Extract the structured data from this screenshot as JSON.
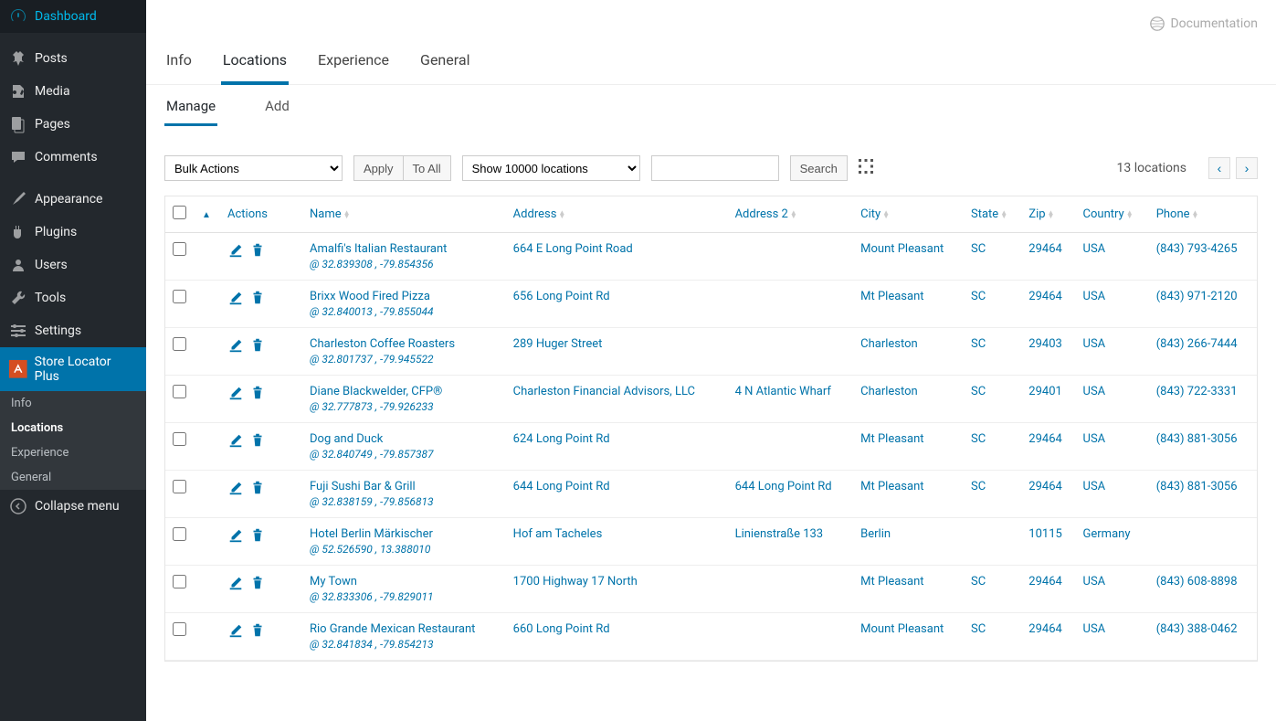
{
  "sidebar": {
    "items": [
      {
        "label": "Dashboard",
        "icon": "dashboard"
      },
      {
        "label": "Posts",
        "icon": "pin"
      },
      {
        "label": "Media",
        "icon": "media"
      },
      {
        "label": "Pages",
        "icon": "pages"
      },
      {
        "label": "Comments",
        "icon": "comments"
      },
      {
        "label": "Appearance",
        "icon": "appearance"
      },
      {
        "label": "Plugins",
        "icon": "plugins"
      },
      {
        "label": "Users",
        "icon": "users"
      },
      {
        "label": "Tools",
        "icon": "tools"
      },
      {
        "label": "Settings",
        "icon": "settings"
      },
      {
        "label": "Store Locator Plus",
        "icon": "slp",
        "active": true
      },
      {
        "label": "Collapse menu",
        "icon": "collapse"
      }
    ],
    "sub": [
      {
        "label": "Info"
      },
      {
        "label": "Locations",
        "active": true
      },
      {
        "label": "Experience"
      },
      {
        "label": "General"
      }
    ]
  },
  "header": {
    "documentation": "Documentation"
  },
  "tabs_primary": [
    {
      "label": "Info"
    },
    {
      "label": "Locations",
      "active": true
    },
    {
      "label": "Experience"
    },
    {
      "label": "General"
    }
  ],
  "tabs_secondary": [
    {
      "label": "Manage",
      "active": true
    },
    {
      "label": "Add"
    }
  ],
  "toolbar": {
    "bulk_actions": "Bulk Actions",
    "apply": "Apply",
    "to_all": "To All",
    "show_locations": "Show 10000 locations",
    "search": "Search",
    "count": "13 locations"
  },
  "columns": {
    "actions": "Actions",
    "name": "Name",
    "address": "Address",
    "address2": "Address 2",
    "city": "City",
    "state": "State",
    "zip": "Zip",
    "country": "Country",
    "phone": "Phone"
  },
  "rows": [
    {
      "name": "Amalfi's Italian Restaurant",
      "coords": "@ 32.839308 , -79.854356",
      "address": "664 E Long Point Road",
      "address2": "",
      "city": "Mount Pleasant",
      "state": "SC",
      "zip": "29464",
      "country": "USA",
      "phone": "(843) 793-4265"
    },
    {
      "name": "Brixx Wood Fired Pizza",
      "coords": "@ 32.840013 , -79.855044",
      "address": "656 Long Point Rd",
      "address2": "",
      "city": "Mt Pleasant",
      "state": "SC",
      "zip": "29464",
      "country": "USA",
      "phone": "(843) 971-2120"
    },
    {
      "name": "Charleston Coffee Roasters",
      "coords": "@ 32.801737 , -79.945522",
      "address": "289 Huger Street",
      "address2": "",
      "city": "Charleston",
      "state": "SC",
      "zip": "29403",
      "country": "USA",
      "phone": "(843) 266-7444"
    },
    {
      "name": "Diane Blackwelder, CFP®",
      "coords": "@ 32.777873 , -79.926233",
      "address": "Charleston Financial Advisors, LLC",
      "address2": "4 N Atlantic Wharf",
      "city": "Charleston",
      "state": "SC",
      "zip": "29401",
      "country": "USA",
      "phone": "(843) 722-3331"
    },
    {
      "name": "Dog and Duck",
      "coords": "@ 32.840749 , -79.857387",
      "address": "624 Long Point Rd",
      "address2": "",
      "city": "Mt Pleasant",
      "state": "SC",
      "zip": "29464",
      "country": "USA",
      "phone": "(843) 881-3056"
    },
    {
      "name": "Fuji Sushi Bar & Grill",
      "coords": "@ 32.838159 , -79.856813",
      "address": "644 Long Point Rd",
      "address2": "644 Long Point Rd",
      "city": "Mt Pleasant",
      "state": "SC",
      "zip": "29464",
      "country": "USA",
      "phone": "(843) 881-3056"
    },
    {
      "name": "Hotel Berlin Märkischer",
      "coords": "@ 52.526590 , 13.388010",
      "address": "Hof am Tacheles",
      "address2": "Linienstraße 133",
      "city": "Berlin",
      "state": "",
      "zip": "10115",
      "country": "Germany",
      "phone": ""
    },
    {
      "name": "My Town",
      "coords": "@ 32.833306 , -79.829011",
      "address": "1700 Highway 17 North",
      "address2": "",
      "city": "Mt Pleasant",
      "state": "SC",
      "zip": "29464",
      "country": "USA",
      "phone": "(843) 608-8898"
    },
    {
      "name": "Rio Grande Mexican Restaurant",
      "coords": "@ 32.841834 , -79.854213",
      "address": "660 Long Point Rd",
      "address2": "",
      "city": "Mount Pleasant",
      "state": "SC",
      "zip": "29464",
      "country": "USA",
      "phone": "(843) 388-0462"
    }
  ]
}
